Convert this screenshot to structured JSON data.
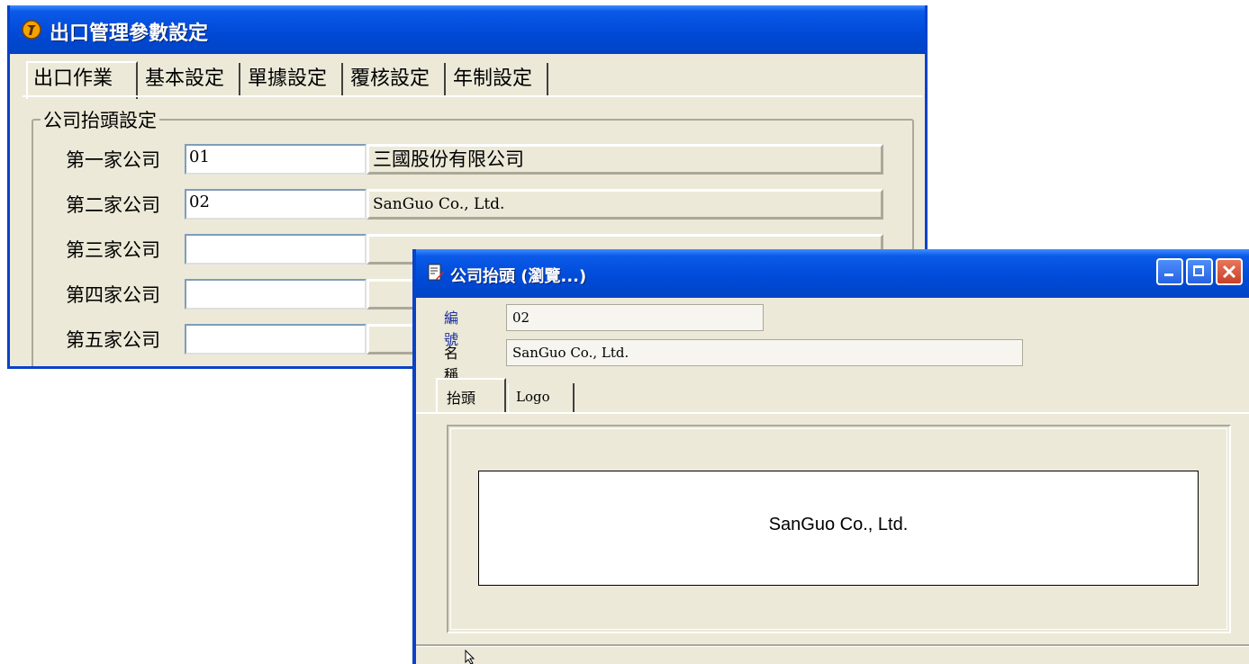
{
  "main_window": {
    "title": "出口管理參數設定",
    "tabs": [
      "出口作業",
      "基本設定",
      "單據設定",
      "覆核設定",
      "年制設定"
    ],
    "group_title": "公司抬頭設定",
    "companies": [
      {
        "label": "第一家公司",
        "code": "01",
        "name": "三國股份有限公司"
      },
      {
        "label": "第二家公司",
        "code": "02",
        "name": "SanGuo Co., Ltd."
      },
      {
        "label": "第三家公司",
        "code": "",
        "name": ""
      },
      {
        "label": "第四家公司",
        "code": "",
        "name": ""
      },
      {
        "label": "第五家公司",
        "code": "",
        "name": ""
      }
    ]
  },
  "popup": {
    "title": "公司抬頭 (瀏覽...)",
    "number_label": "編號",
    "number_value": "02",
    "name_label": "名稱",
    "name_value": "SanGuo Co., Ltd.",
    "tabs": [
      "抬頭",
      "Logo"
    ],
    "header_preview": "SanGuo Co., Ltd."
  },
  "colors": {
    "titlebar": "#0a5ae8",
    "window_bg": "#ece9d8",
    "number_label": "#1a2fa0",
    "close_button": "#d4502f"
  }
}
